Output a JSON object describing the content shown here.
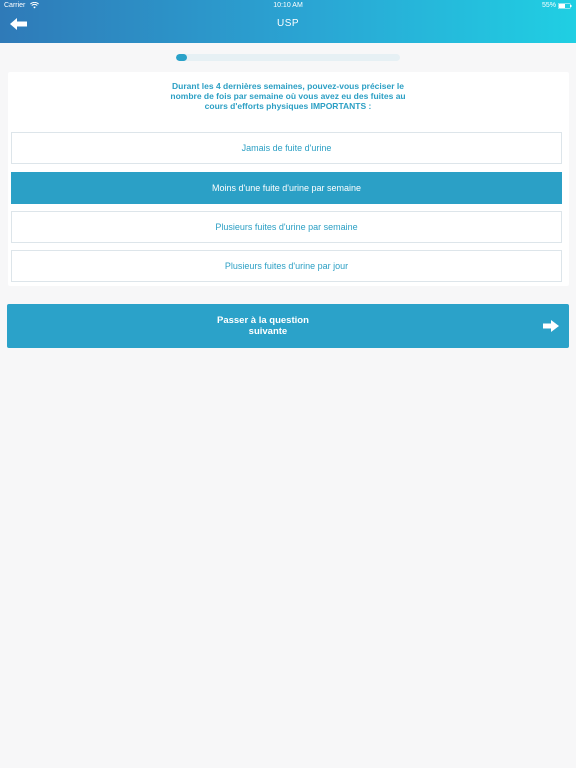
{
  "status_bar": {
    "carrier": "Carrier",
    "time": "10:10 AM",
    "battery": "55%"
  },
  "header": {
    "title": "USP",
    "back_icon": "arrow-left-icon",
    "gradient_colors": [
      "#2f7ab8",
      "#20cfe3"
    ]
  },
  "progress": {
    "value": 0.05,
    "color": "#2aa2c9"
  },
  "question": {
    "text": "Durant les 4 dernières semaines, pouvez-vous préciser le nombre de fois par semaine où vous avez eu des fuites au cours d'efforts physiques IMPORTANTS :"
  },
  "options": [
    {
      "label": "Jamais de fuite d'urine",
      "selected": false
    },
    {
      "label": "Moins d'une fuite d'urine par semaine",
      "selected": true
    },
    {
      "label": "Plusieurs fuites d'urine par semaine",
      "selected": false
    },
    {
      "label": "Plusieurs fuites d'urine par jour",
      "selected": false
    }
  ],
  "next_button": {
    "label": "Passer à la question\n            suivante",
    "icon": "arrow-right-icon"
  },
  "colors": {
    "accent": "#2ba0c6",
    "background": "#f7f7f8"
  }
}
